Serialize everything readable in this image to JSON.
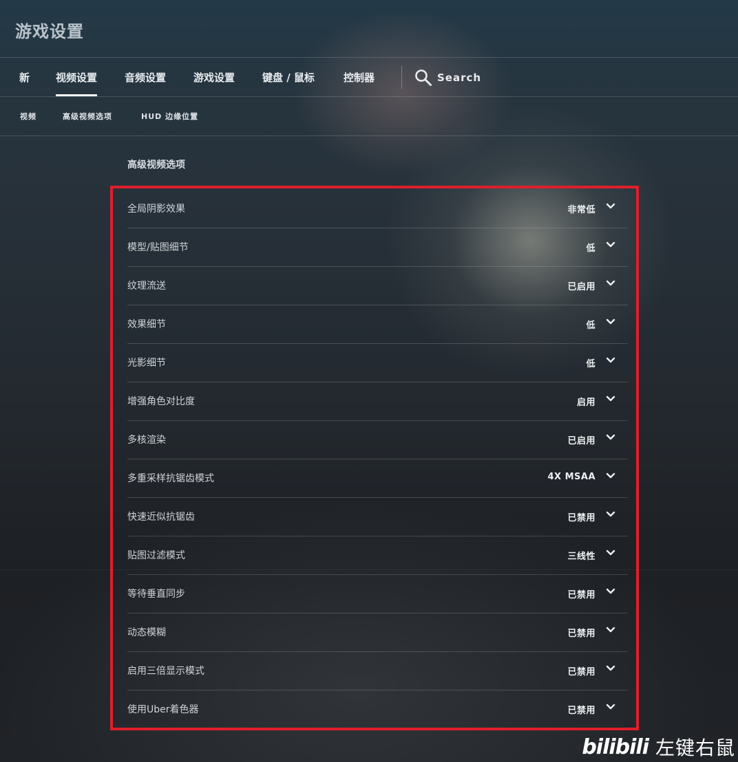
{
  "app": {
    "title": "游戏设置"
  },
  "main_nav": {
    "tabs": [
      {
        "label": "新",
        "active": false
      },
      {
        "label": "视频设置",
        "active": true
      },
      {
        "label": "音频设置",
        "active": false
      },
      {
        "label": "游戏设置",
        "active": false
      },
      {
        "label": "键盘 / 鼠标",
        "active": false
      },
      {
        "label": "控制器",
        "active": false
      }
    ],
    "search": {
      "label": "Search",
      "icon": "search-icon"
    }
  },
  "sub_nav": {
    "tabs": [
      {
        "label": "视频"
      },
      {
        "label": "高级视频选项"
      },
      {
        "label": "HUD 边缘位置"
      }
    ]
  },
  "section": {
    "title": "高级视频选项",
    "highlight_color": "#e01e2b",
    "settings": [
      {
        "label": "全局阴影效果",
        "value": "非常低"
      },
      {
        "label": "模型/贴图细节",
        "value": "低"
      },
      {
        "label": "纹理流送",
        "value": "已启用"
      },
      {
        "label": "效果细节",
        "value": "低"
      },
      {
        "label": "光影细节",
        "value": "低"
      },
      {
        "label": "增强角色对比度",
        "value": "启用"
      },
      {
        "label": "多核渲染",
        "value": "已启用"
      },
      {
        "label": "多重采样抗锯齿模式",
        "value": "4X MSAA"
      },
      {
        "label": "快速近似抗锯齿",
        "value": "已禁用"
      },
      {
        "label": "贴图过滤模式",
        "value": "三线性"
      },
      {
        "label": "等待垂直同步",
        "value": "已禁用"
      },
      {
        "label": "动态模糊",
        "value": "已禁用"
      },
      {
        "label": "启用三倍显示模式",
        "value": "已禁用"
      },
      {
        "label": "使用Uber着色器",
        "value": "已禁用"
      }
    ]
  },
  "watermark": {
    "logo": "bilibili",
    "text": "左键右鼠"
  }
}
